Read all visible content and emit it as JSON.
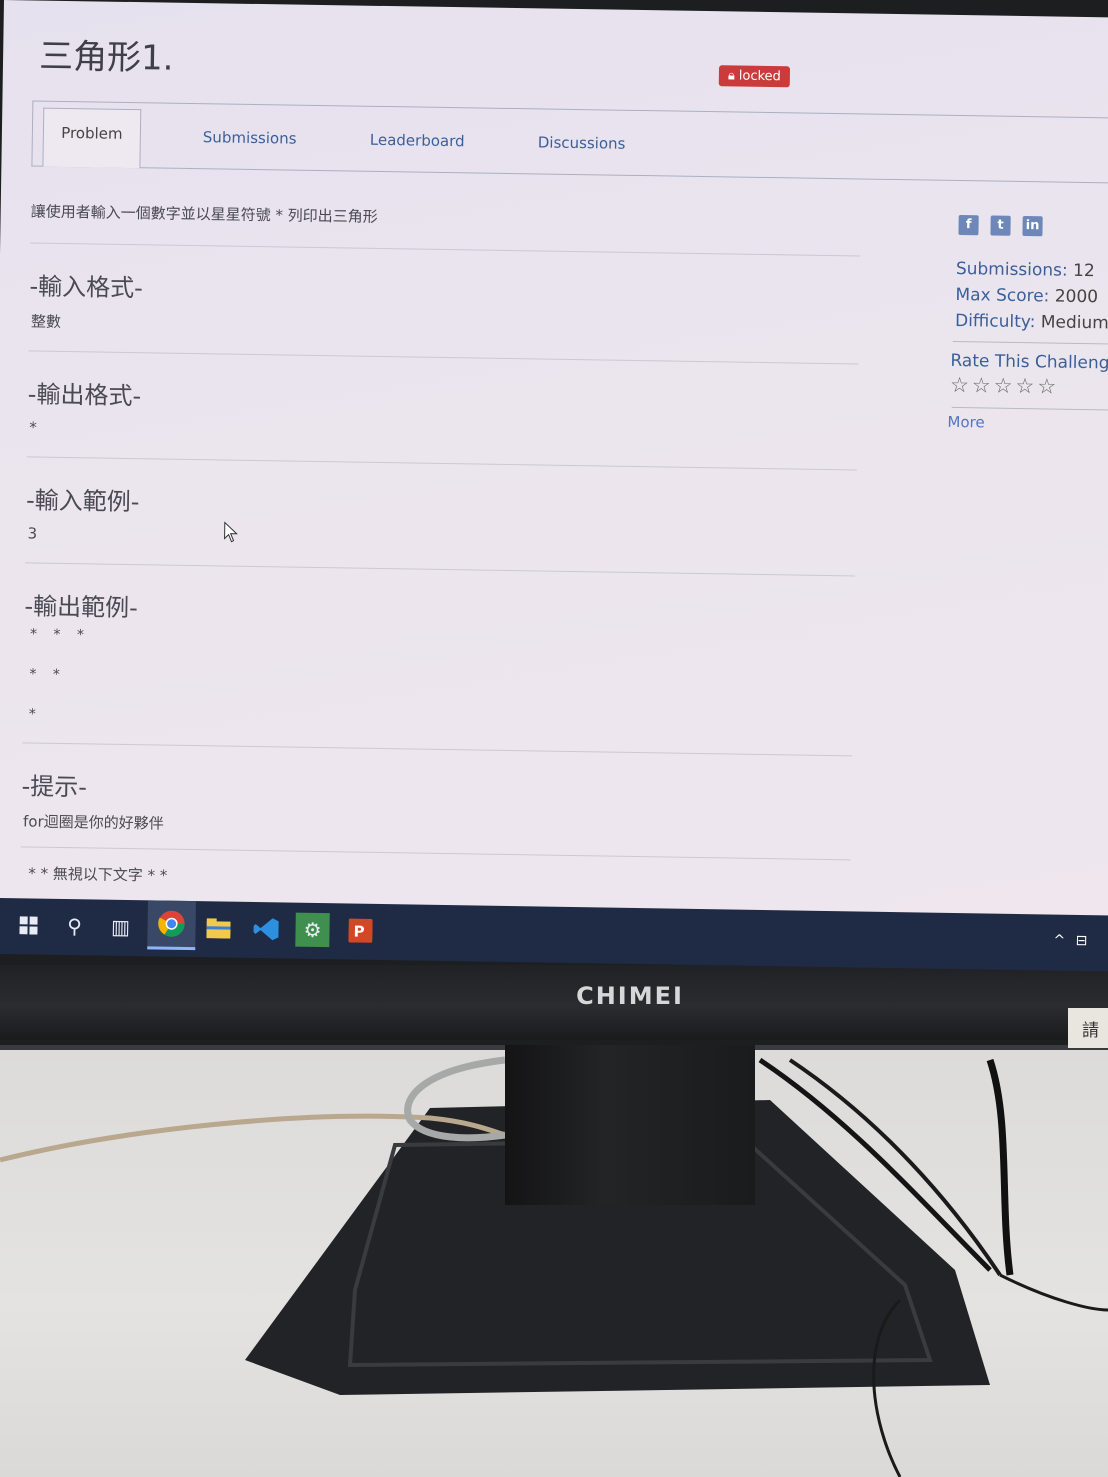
{
  "page": {
    "title": "三角形1.",
    "badge": "locked"
  },
  "tabs": [
    "Problem",
    "Submissions",
    "Leaderboard",
    "Discussions"
  ],
  "problem": {
    "description": "讓使用者輸入一個數字並以星星符號 * 列印出三角形",
    "sections": [
      {
        "heading": "-輸入格式-",
        "body": "整數"
      },
      {
        "heading": "-輸出格式-",
        "body": "*"
      },
      {
        "heading": "-輸入範例-",
        "body": "3"
      },
      {
        "heading": "-輸出範例-",
        "lines": [
          "* * *",
          "* *",
          "*"
        ]
      },
      {
        "heading": "-提示-",
        "body": "for迴圈是你的好夥伴"
      }
    ],
    "footer_note": "* * 無視以下文字 * *"
  },
  "sidebar": {
    "social": [
      "f",
      "t",
      "in"
    ],
    "submissions_label": "Submissions:",
    "submissions_value": "12",
    "max_score_label": "Max Score:",
    "max_score_value": "2000",
    "difficulty_label": "Difficulty:",
    "difficulty_value": "Medium",
    "rate_title": "Rate This Challenge",
    "stars": "☆☆☆☆☆",
    "more": "More"
  },
  "monitor": {
    "brand": "CHIMEI",
    "sticker": "請"
  }
}
